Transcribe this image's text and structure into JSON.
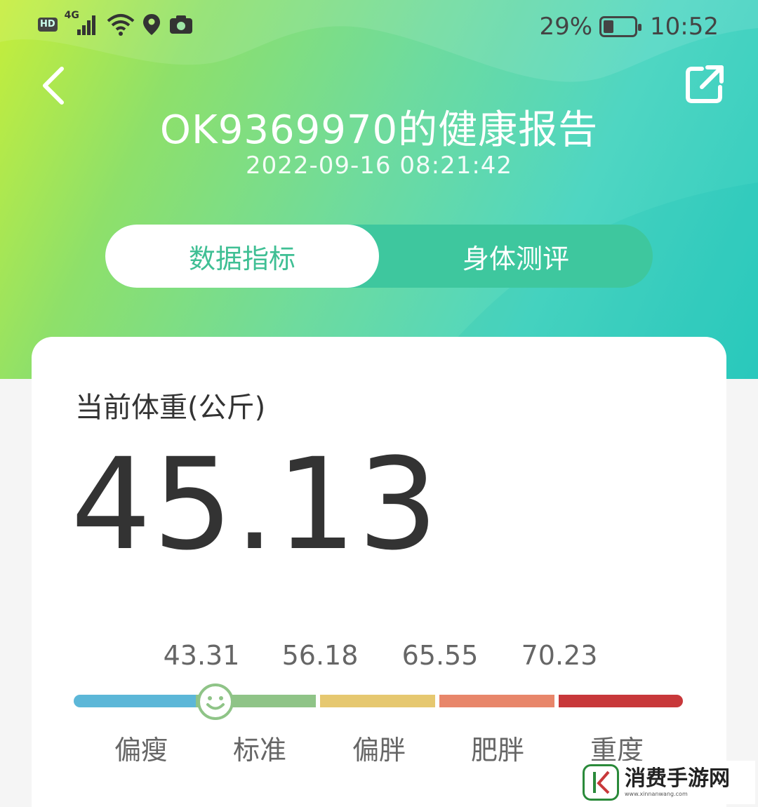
{
  "status_bar": {
    "hd": "HD",
    "network": "4G",
    "battery_percent": "29%",
    "battery_level": 0.29,
    "time": "10:52"
  },
  "header": {
    "title": "OK9369970的健康报告",
    "datetime": "2022-09-16 08:21:42",
    "icons": {
      "back": "chevron-left-icon",
      "share": "share-icon"
    }
  },
  "tabs": [
    {
      "label": "数据指标",
      "active": true
    },
    {
      "label": "身体测评",
      "active": false
    }
  ],
  "weight": {
    "label": "当前体重(公斤)",
    "value": "45.13",
    "scale_thresholds": [
      "43.31",
      "56.18",
      "65.55",
      "70.23"
    ],
    "scale_categories": [
      "偏瘦",
      "标准",
      "偏胖",
      "肥胖",
      "重度"
    ],
    "scale_colors": [
      "#5cb7d8",
      "#8fc487",
      "#e6c870",
      "#e8866a",
      "#c8383a"
    ]
  },
  "watermark": {
    "text": "消费手游网",
    "url": "www.xinnanwang.com"
  }
}
